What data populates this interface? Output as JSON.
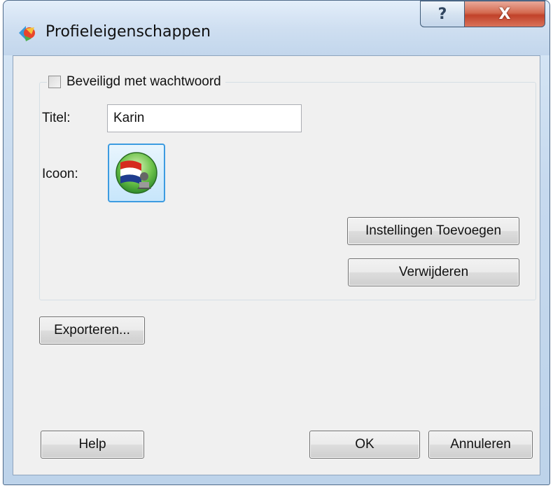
{
  "window": {
    "title": "Profieleigenschappen",
    "help_symbol": "?",
    "close_symbol": "X"
  },
  "group": {
    "password_label": "Beveiligd met wachtwoord",
    "password_checked": false
  },
  "form": {
    "title_label": "Titel:",
    "title_value": "Karin",
    "icon_label": "Icoon:",
    "icon_name": "dutch-flag-user-icon"
  },
  "buttons": {
    "add_settings": "Instellingen Toevoegen",
    "remove": "Verwijderen",
    "export": "Exporteren...",
    "help": "Help",
    "ok": "OK",
    "cancel": "Annuleren"
  },
  "colors": {
    "close_button": "#c1422a",
    "icon_highlight": "#3c9be0",
    "flag_red": "#d52b1e",
    "flag_white": "#ffffff",
    "flag_blue": "#1f3d8f"
  }
}
